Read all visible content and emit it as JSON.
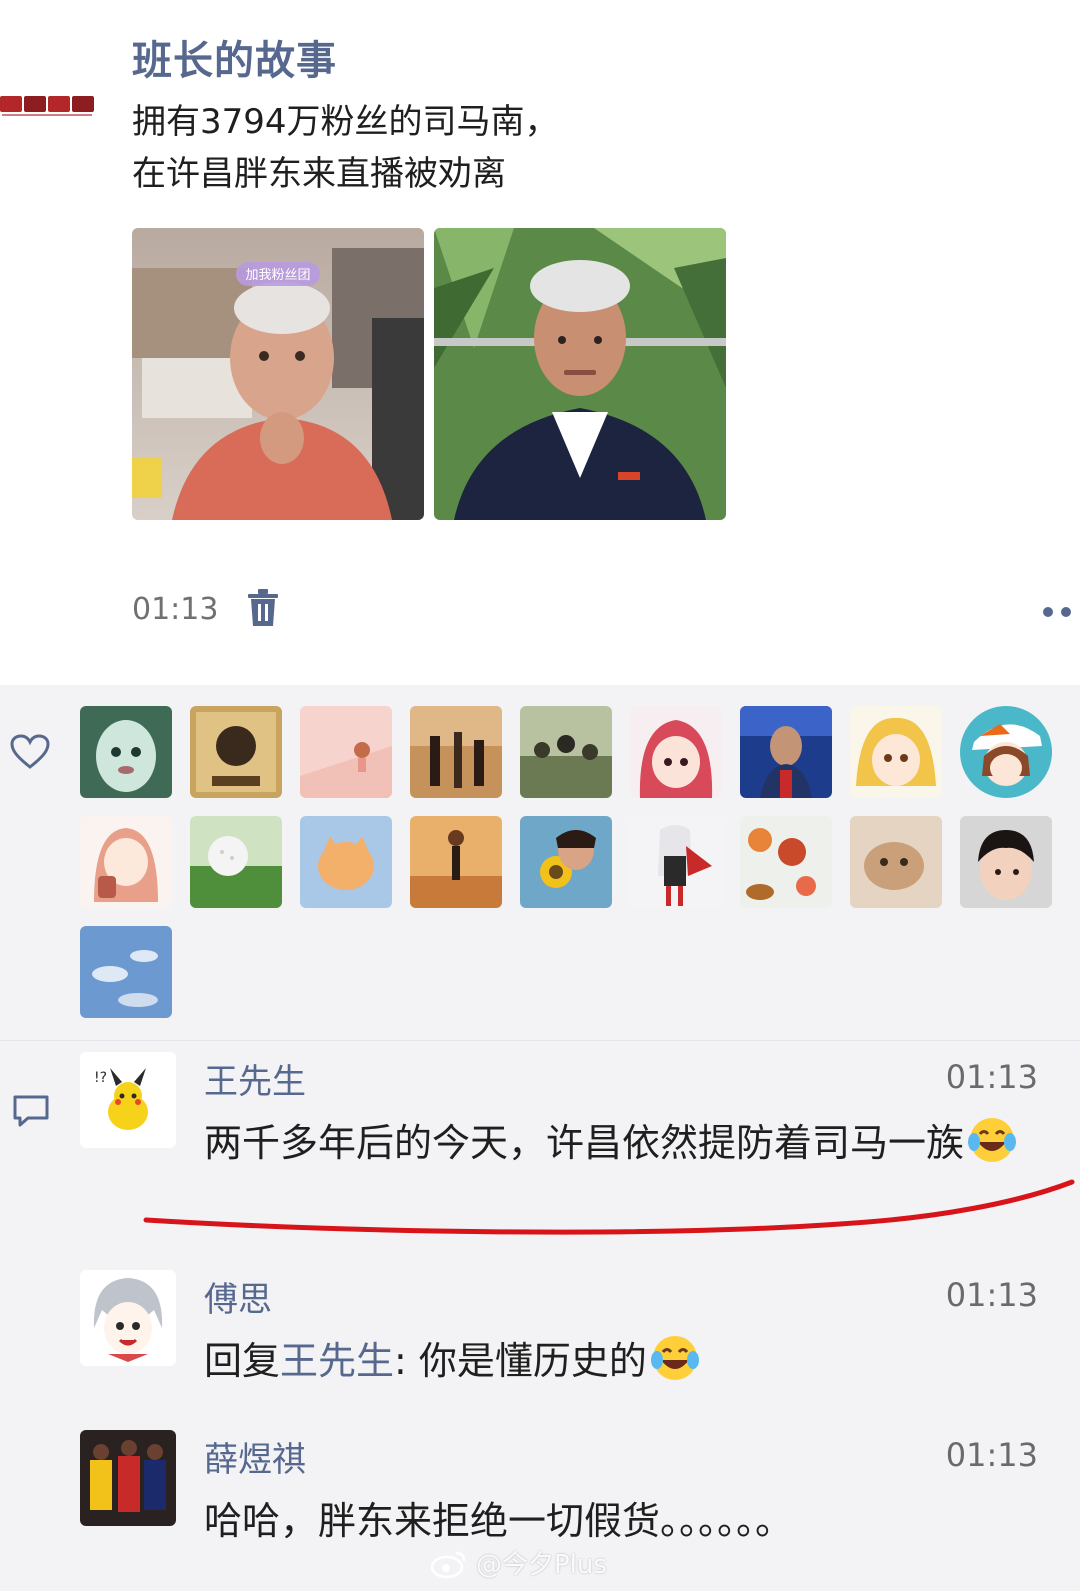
{
  "post": {
    "author": "班长的故事",
    "text_lines": [
      "拥有3794万粉丝的司马南，",
      "在许昌胖东来直播被劝离"
    ],
    "photos": [
      {
        "overlay_tag": "加我粉丝团",
        "icon": "photo-livestream"
      },
      {
        "icon": "photo-portrait"
      }
    ],
    "time": "01:13",
    "icons": {
      "delete": "trash-icon",
      "more": "more-dots-icon"
    }
  },
  "likes": {
    "icon": "heart-icon",
    "count_rows": 3,
    "avatars": [
      {
        "icon": "avatar-baby-face"
      },
      {
        "icon": "avatar-wanted-poster"
      },
      {
        "icon": "avatar-pink-girl"
      },
      {
        "icon": "avatar-street"
      },
      {
        "icon": "avatar-crowd"
      },
      {
        "icon": "avatar-anime-red-hair"
      },
      {
        "icon": "avatar-spiderman"
      },
      {
        "icon": "avatar-anime-blonde"
      },
      {
        "icon": "avatar-anime-hat"
      },
      {
        "icon": "avatar-anime-backpack"
      },
      {
        "icon": "avatar-golf-ball"
      },
      {
        "icon": "avatar-orange-cat"
      },
      {
        "icon": "avatar-runner"
      },
      {
        "icon": "avatar-sunflower"
      },
      {
        "icon": "avatar-anime-swordswoman"
      },
      {
        "icon": "avatar-food"
      },
      {
        "icon": "avatar-cat-photo"
      },
      {
        "icon": "avatar-toddler"
      },
      {
        "icon": "avatar-sky"
      }
    ]
  },
  "comments": {
    "icon": "comment-icon",
    "items": [
      {
        "name": "王先生",
        "time": "01:13",
        "body_text": "两千多年后的今天，许昌依然提防着司马一族",
        "emoji": "laugh-cry-emoji",
        "avatar": "avatar-pikachu",
        "highlighted": true
      },
      {
        "name": "傅思",
        "time": "01:13",
        "reply_prefix": "回复",
        "reply_to": "王先生",
        "body_text": ": 你是懂历史的",
        "emoji": "laugh-cry-emoji",
        "avatar": "avatar-anime-boy"
      },
      {
        "name": "薛煜祺",
        "time": "01:13",
        "body_text": "哈哈，胖东来拒绝一切假货。。。。。。",
        "avatar": "avatar-basketball"
      }
    ]
  },
  "watermark": "@今夕Plus",
  "colors": {
    "name_link": "#57688f",
    "panel_bg": "#f3f3f5",
    "highlight_line": "#d8141b"
  }
}
